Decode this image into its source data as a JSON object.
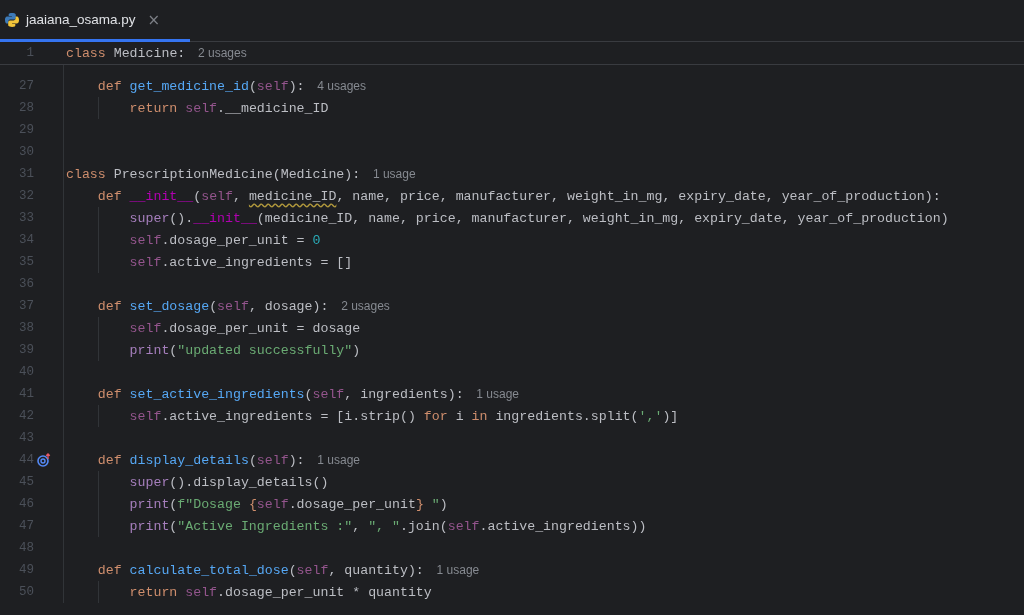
{
  "tabs": [
    {
      "label": "jaaiana_osama.py",
      "close": "×",
      "selected": true
    }
  ],
  "sticky_line": {
    "number": "1",
    "tokens": [
      {
        "kind": "kw",
        "text": "class "
      },
      {
        "kind": "plain",
        "text": "Medicine:"
      }
    ],
    "hint": "2 usages",
    "children": [
      {
        "number": "27",
        "tokens": [
          {
            "kind": "kw",
            "text": "def "
          },
          {
            "kind": "fn",
            "text": "get_medicine_id"
          },
          {
            "kind": "plain",
            "text": "("
          },
          {
            "kind": "self",
            "text": "self"
          },
          {
            "kind": "plain",
            "text": "):"
          }
        ],
        "hint": "4 usages",
        "children": [
          {
            "number": "28",
            "tokens": [
              {
                "kind": "kw",
                "text": "return "
              },
              {
                "kind": "self",
                "text": "self"
              },
              {
                "kind": "plain",
                "text": ".__medicine_ID"
              }
            ]
          }
        ]
      },
      {
        "number": "29"
      },
      {
        "number": "30"
      }
    ]
  },
  "lines": [
    {
      "number": "31",
      "tokens": [
        {
          "kind": "kw",
          "text": "class "
        },
        {
          "kind": "plain",
          "text": "PrescriptionMedicine(Medicine):"
        }
      ],
      "hint": "1 usage",
      "children": [
        {
          "number": "32",
          "tokens": [
            {
              "kind": "kw",
              "text": "def "
            },
            {
              "kind": "dunder",
              "text": "__init__"
            },
            {
              "kind": "plain",
              "text": "("
            },
            {
              "kind": "self",
              "text": "self"
            },
            {
              "kind": "plain",
              "text": ", "
            },
            {
              "kind": "warn",
              "text": "medicine_ID"
            },
            {
              "kind": "plain",
              "text": ", name, price, manufacturer, weight_in_mg, expiry_date, year_of_production):"
            }
          ],
          "children": [
            {
              "number": "33",
              "tokens": [
                {
                  "kind": "builtin",
                  "text": "super"
                },
                {
                  "kind": "plain",
                  "text": "()."
                },
                {
                  "kind": "dunder",
                  "text": "__init__"
                },
                {
                  "kind": "plain",
                  "text": "(medicine_ID, name, price, manufacturer, weight_in_mg, expiry_date, year_of_production)"
                }
              ]
            },
            {
              "number": "34",
              "tokens": [
                {
                  "kind": "self",
                  "text": "self"
                },
                {
                  "kind": "plain",
                  "text": ".dosage_per_unit = "
                },
                {
                  "kind": "num",
                  "text": "0"
                }
              ]
            },
            {
              "number": "35",
              "tokens": [
                {
                  "kind": "self",
                  "text": "self"
                },
                {
                  "kind": "plain",
                  "text": ".active_ingredients = []"
                }
              ]
            }
          ]
        },
        {
          "number": "36"
        },
        {
          "number": "37",
          "tokens": [
            {
              "kind": "kw",
              "text": "def "
            },
            {
              "kind": "fn",
              "text": "set_dosage"
            },
            {
              "kind": "plain",
              "text": "("
            },
            {
              "kind": "self",
              "text": "self"
            },
            {
              "kind": "plain",
              "text": ", dosage):"
            }
          ],
          "hint": "2 usages",
          "children": [
            {
              "number": "38",
              "tokens": [
                {
                  "kind": "self",
                  "text": "self"
                },
                {
                  "kind": "plain",
                  "text": ".dosage_per_unit = dosage"
                }
              ]
            },
            {
              "number": "39",
              "tokens": [
                {
                  "kind": "builtin",
                  "text": "print"
                },
                {
                  "kind": "plain",
                  "text": "("
                },
                {
                  "kind": "str",
                  "text": "\"updated successfully\""
                },
                {
                  "kind": "plain",
                  "text": ")"
                }
              ]
            }
          ]
        },
        {
          "number": "40"
        },
        {
          "number": "41",
          "tokens": [
            {
              "kind": "kw",
              "text": "def "
            },
            {
              "kind": "fn",
              "text": "set_active_ingredients"
            },
            {
              "kind": "plain",
              "text": "("
            },
            {
              "kind": "self",
              "text": "self"
            },
            {
              "kind": "plain",
              "text": ", ingredients):"
            }
          ],
          "hint": "1 usage",
          "children": [
            {
              "number": "42",
              "tokens": [
                {
                  "kind": "self",
                  "text": "self"
                },
                {
                  "kind": "plain",
                  "text": ".active_ingredients = [i.strip() "
                },
                {
                  "kind": "kw",
                  "text": "for "
                },
                {
                  "kind": "plain",
                  "text": "i "
                },
                {
                  "kind": "kw",
                  "text": "in "
                },
                {
                  "kind": "plain",
                  "text": "ingredients.split("
                },
                {
                  "kind": "str",
                  "text": "','"
                },
                {
                  "kind": "plain",
                  "text": ")]"
                }
              ]
            }
          ]
        },
        {
          "number": "43"
        },
        {
          "number": "44",
          "marker": true,
          "tokens": [
            {
              "kind": "kw",
              "text": "def "
            },
            {
              "kind": "fn",
              "text": "display_details"
            },
            {
              "kind": "plain",
              "text": "("
            },
            {
              "kind": "self",
              "text": "self"
            },
            {
              "kind": "plain",
              "text": "):"
            }
          ],
          "hint": "1 usage",
          "children": [
            {
              "number": "45",
              "tokens": [
                {
                  "kind": "builtin",
                  "text": "super"
                },
                {
                  "kind": "plain",
                  "text": "().display_details()"
                }
              ]
            },
            {
              "number": "46",
              "tokens": [
                {
                  "kind": "builtin",
                  "text": "print"
                },
                {
                  "kind": "plain",
                  "text": "("
                },
                {
                  "kind": "str",
                  "text": "f\"Dosage "
                },
                {
                  "kind": "kw",
                  "text": "{"
                },
                {
                  "kind": "self",
                  "text": "self"
                },
                {
                  "kind": "plain",
                  "text": ".dosage_per_unit"
                },
                {
                  "kind": "kw",
                  "text": "}"
                },
                {
                  "kind": "str",
                  "text": " \""
                },
                {
                  "kind": "plain",
                  "text": ")"
                }
              ]
            },
            {
              "number": "47",
              "tokens": [
                {
                  "kind": "builtin",
                  "text": "print"
                },
                {
                  "kind": "plain",
                  "text": "("
                },
                {
                  "kind": "str",
                  "text": "\"Active Ingredients :\""
                },
                {
                  "kind": "plain",
                  "text": ", "
                },
                {
                  "kind": "str",
                  "text": "\", \""
                },
                {
                  "kind": "plain",
                  "text": ".join("
                },
                {
                  "kind": "self",
                  "text": "self"
                },
                {
                  "kind": "plain",
                  "text": ".active_ingredients))"
                }
              ]
            }
          ]
        },
        {
          "number": "48"
        },
        {
          "number": "49",
          "tokens": [
            {
              "kind": "kw",
              "text": "def "
            },
            {
              "kind": "fn",
              "text": "calculate_total_dose"
            },
            {
              "kind": "plain",
              "text": "("
            },
            {
              "kind": "self",
              "text": "self"
            },
            {
              "kind": "plain",
              "text": ", quantity):"
            }
          ],
          "hint": "1 usage",
          "children": [
            {
              "number": "50",
              "tokens": [
                {
                  "kind": "kw",
                  "text": "return "
                },
                {
                  "kind": "self",
                  "text": "self"
                },
                {
                  "kind": "plain",
                  "text": ".dosage_per_unit * quantity"
                }
              ]
            }
          ]
        }
      ]
    }
  ]
}
